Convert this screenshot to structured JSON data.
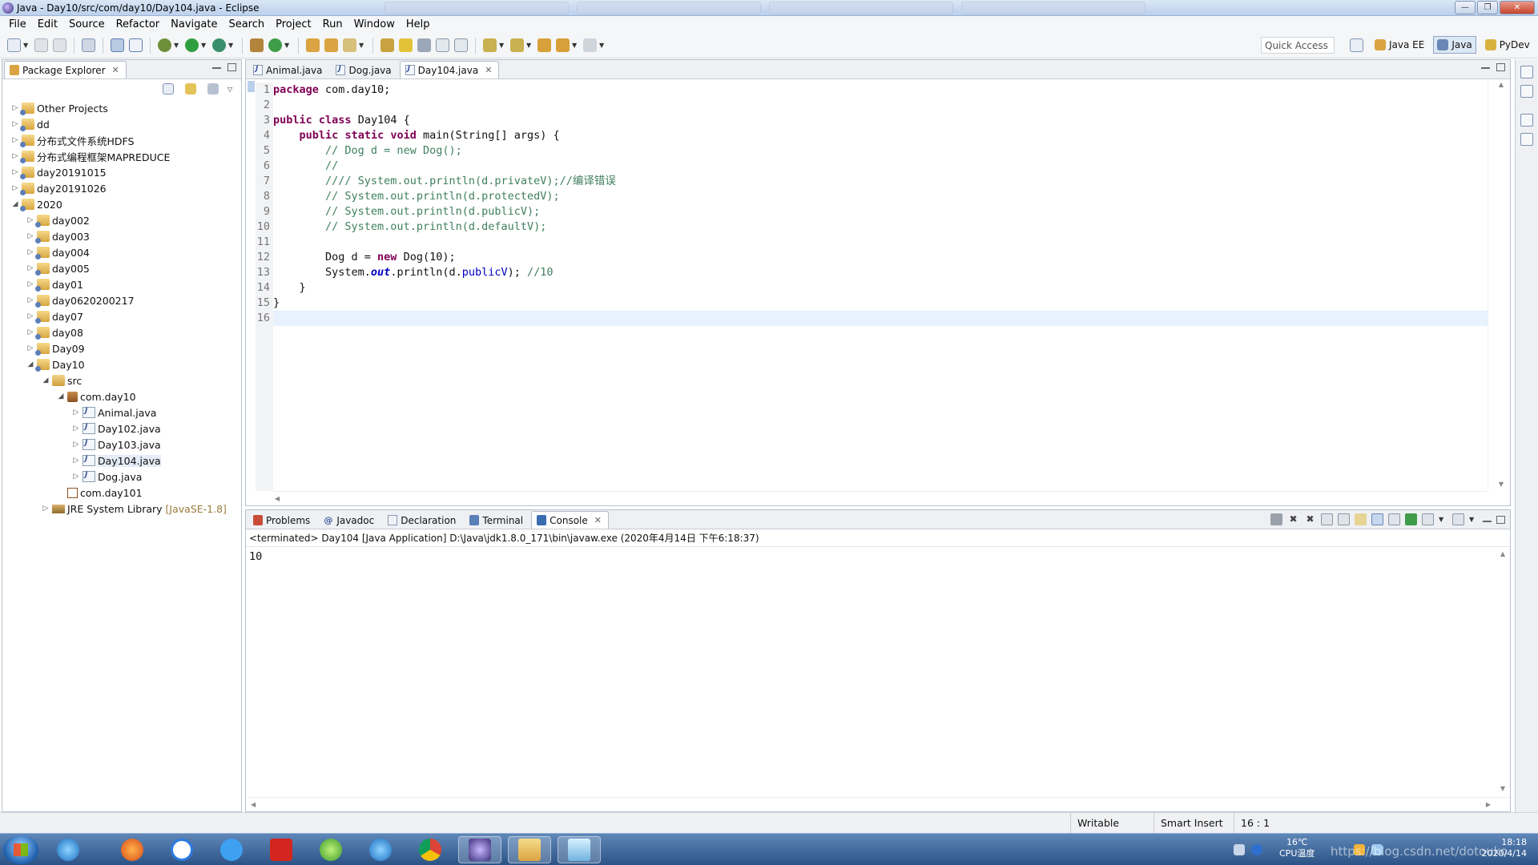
{
  "window": {
    "title": "Java - Day10/src/com/day10/Day104.java - Eclipse",
    "controls": [
      "—",
      "❐",
      "✕"
    ]
  },
  "menu": [
    "File",
    "Edit",
    "Source",
    "Refactor",
    "Navigate",
    "Search",
    "Project",
    "Run",
    "Window",
    "Help"
  ],
  "toolbar": {
    "quick_access": "Quick Access",
    "perspectives": [
      {
        "label": "Java EE",
        "active": false
      },
      {
        "label": "Java",
        "active": true
      },
      {
        "label": "PyDev",
        "active": false
      }
    ]
  },
  "package_explorer": {
    "title": "Package Explorer",
    "tree": [
      {
        "depth": 0,
        "label": "Other Projects",
        "type": "project",
        "expanded": false
      },
      {
        "depth": 0,
        "label": "dd",
        "type": "project",
        "expanded": false
      },
      {
        "depth": 0,
        "label": "分布式文件系统HDFS",
        "type": "project",
        "expanded": false
      },
      {
        "depth": 0,
        "label": "分布式编程框架MAPREDUCE",
        "type": "project",
        "expanded": false
      },
      {
        "depth": 0,
        "label": "day20191015",
        "type": "project",
        "expanded": false
      },
      {
        "depth": 0,
        "label": "day20191026",
        "type": "project",
        "expanded": false
      },
      {
        "depth": 0,
        "label": "2020",
        "type": "project",
        "expanded": true
      },
      {
        "depth": 1,
        "label": "day002",
        "type": "project",
        "expanded": false
      },
      {
        "depth": 1,
        "label": "day003",
        "type": "project",
        "expanded": false
      },
      {
        "depth": 1,
        "label": "day004",
        "type": "project",
        "expanded": false
      },
      {
        "depth": 1,
        "label": "day005",
        "type": "project",
        "expanded": false
      },
      {
        "depth": 1,
        "label": "day01",
        "type": "project",
        "expanded": false
      },
      {
        "depth": 1,
        "label": "day0620200217",
        "type": "project",
        "expanded": false
      },
      {
        "depth": 1,
        "label": "day07",
        "type": "project",
        "expanded": false
      },
      {
        "depth": 1,
        "label": "day08",
        "type": "project",
        "expanded": false
      },
      {
        "depth": 1,
        "label": "Day09",
        "type": "project",
        "expanded": false
      },
      {
        "depth": 1,
        "label": "Day10",
        "type": "project",
        "expanded": true
      },
      {
        "depth": 2,
        "label": "src",
        "type": "src",
        "expanded": true
      },
      {
        "depth": 3,
        "label": "com.day10",
        "type": "package",
        "expanded": true
      },
      {
        "depth": 4,
        "label": "Animal.java",
        "type": "java",
        "expanded": false
      },
      {
        "depth": 4,
        "label": "Day102.java",
        "type": "java",
        "expanded": false
      },
      {
        "depth": 4,
        "label": "Day103.java",
        "type": "java",
        "expanded": false
      },
      {
        "depth": 4,
        "label": "Day104.java",
        "type": "java",
        "expanded": false,
        "selected": true
      },
      {
        "depth": 4,
        "label": "Dog.java",
        "type": "java",
        "expanded": false
      },
      {
        "depth": 3,
        "label": "com.day101",
        "type": "package-empty",
        "expanded": null
      },
      {
        "depth": 2,
        "label": "JRE System Library",
        "type": "library",
        "expanded": false,
        "decoration": "[JavaSE-1.8]"
      }
    ]
  },
  "editor": {
    "tabs": [
      {
        "label": "Animal.java",
        "active": false
      },
      {
        "label": "Dog.java",
        "active": false
      },
      {
        "label": "Day104.java",
        "active": true
      }
    ],
    "line_numbers": [
      "1",
      "2",
      "3",
      "4",
      "5",
      "6",
      "7",
      "8",
      "9",
      "10",
      "11",
      "12",
      "13",
      "14",
      "15",
      "16"
    ],
    "lines": [
      [
        {
          "t": "kw",
          "v": "package"
        },
        {
          "t": "",
          "v": " com.day10;"
        }
      ],
      [],
      [
        {
          "t": "kw",
          "v": "public"
        },
        {
          "t": "",
          "v": " "
        },
        {
          "t": "kw",
          "v": "class"
        },
        {
          "t": "",
          "v": " Day104 {"
        }
      ],
      [
        {
          "t": "",
          "v": "    "
        },
        {
          "t": "kw",
          "v": "public"
        },
        {
          "t": "",
          "v": " "
        },
        {
          "t": "kw",
          "v": "static"
        },
        {
          "t": "",
          "v": " "
        },
        {
          "t": "kw",
          "v": "void"
        },
        {
          "t": "",
          "v": " main(String[] args) {"
        }
      ],
      [
        {
          "t": "",
          "v": "        "
        },
        {
          "t": "cm",
          "v": "// Dog d = new Dog();"
        }
      ],
      [
        {
          "t": "",
          "v": "        "
        },
        {
          "t": "cm",
          "v": "//"
        }
      ],
      [
        {
          "t": "",
          "v": "        "
        },
        {
          "t": "cm",
          "v": "//// System.out.println(d.privateV);//编译错误"
        }
      ],
      [
        {
          "t": "",
          "v": "        "
        },
        {
          "t": "cm",
          "v": "// System.out.println(d.protectedV);"
        }
      ],
      [
        {
          "t": "",
          "v": "        "
        },
        {
          "t": "cm",
          "v": "// System.out.println(d.publicV);"
        }
      ],
      [
        {
          "t": "",
          "v": "        "
        },
        {
          "t": "cm",
          "v": "// System.out.println(d.defaultV);"
        }
      ],
      [],
      [
        {
          "t": "",
          "v": "        Dog d = "
        },
        {
          "t": "kw",
          "v": "new"
        },
        {
          "t": "",
          "v": " Dog(10);"
        }
      ],
      [
        {
          "t": "",
          "v": "        System."
        },
        {
          "t": "sfld",
          "v": "out"
        },
        {
          "t": "",
          "v": ".println(d."
        },
        {
          "t": "fld",
          "v": "publicV"
        },
        {
          "t": "",
          "v": "); "
        },
        {
          "t": "cm",
          "v": "//10"
        }
      ],
      [
        {
          "t": "",
          "v": "    }"
        }
      ],
      [
        {
          "t": "",
          "v": "}"
        }
      ],
      []
    ],
    "current_line": 16
  },
  "bottom_panel": {
    "tabs": [
      {
        "label": "Problems",
        "active": false
      },
      {
        "label": "Javadoc",
        "active": false
      },
      {
        "label": "Declaration",
        "active": false
      },
      {
        "label": "Terminal",
        "active": false
      },
      {
        "label": "Console",
        "active": true
      }
    ],
    "console_info": "<terminated> Day104 [Java Application] D:\\Java\\jdk1.8.0_171\\bin\\javaw.exe (2020年4月14日 下午6:18:37)",
    "console_output": "10"
  },
  "status": {
    "writable": "Writable",
    "insert_mode": "Smart Insert",
    "position": "16 : 1"
  },
  "taskbar": {
    "temperature": "16℃",
    "temp_label": "CPU温度",
    "time": "18:18",
    "date": "2020/4/14",
    "watermark": "https://blog.csdn.net/dotouko"
  },
  "colors": {
    "keyword": "#7f0055",
    "comment": "#3f7f5f",
    "field": "#0000c0",
    "current_line": "#e8f2fe"
  }
}
